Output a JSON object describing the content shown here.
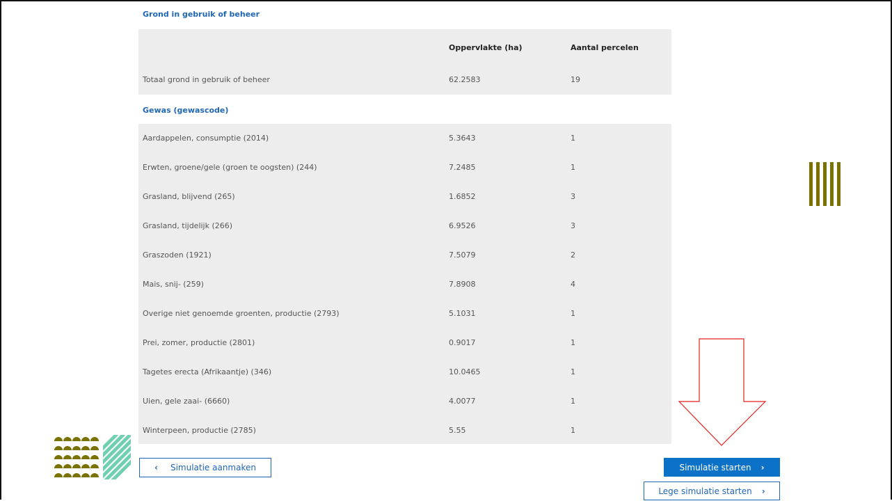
{
  "grond": {
    "title": "Grond in gebruik of beheer",
    "col_area": "Oppervlakte (ha)",
    "col_count": "Aantal percelen",
    "total_label": "Totaal grond in gebruik of beheer",
    "total_area": "62.2583",
    "total_count": "19"
  },
  "gewas": {
    "title": "Gewas (gewascode)",
    "rows": [
      {
        "name": "Aardappelen, consumptie (2014)",
        "area": "5.3643",
        "count": "1"
      },
      {
        "name": "Erwten, groene/gele (groen te oogsten) (244)",
        "area": "7.2485",
        "count": "1"
      },
      {
        "name": "Grasland, blijvend (265)",
        "area": "1.6852",
        "count": "3"
      },
      {
        "name": "Grasland, tijdelijk (266)",
        "area": "6.9526",
        "count": "3"
      },
      {
        "name": "Graszoden (1921)",
        "area": "7.5079",
        "count": "2"
      },
      {
        "name": "Mais, snij- (259)",
        "area": "7.8908",
        "count": "4"
      },
      {
        "name": "Overige niet genoemde groenten, productie (2793)",
        "area": "5.1031",
        "count": "1"
      },
      {
        "name": "Prei, zomer, productie (2801)",
        "area": "0.9017",
        "count": "1"
      },
      {
        "name": "Tagetes erecta (Afrikaantje) (346)",
        "area": "10.0465",
        "count": "1"
      },
      {
        "name": "Uien, gele zaai- (6660)",
        "area": "4.0077",
        "count": "1"
      },
      {
        "name": "Winterpeen, productie (2785)",
        "area": "5.55",
        "count": "1"
      }
    ]
  },
  "buttons": {
    "back_label": "Simulatie aanmaken",
    "back_icon": "‹",
    "start_label": "Simulatie starten",
    "start_icon": "›",
    "empty_label": "Lege simulatie starten",
    "empty_icon": "›"
  },
  "colors": {
    "link_blue": "#1f66b3",
    "primary": "#0b72c7",
    "panel": "#ededed",
    "olive": "#7a7200",
    "teal": "#6fcfb0",
    "arrow_red": "#e0201c"
  },
  "icons": [
    "chevron-left-icon",
    "chevron-right-icon",
    "down-arrow-annotation-icon"
  ]
}
